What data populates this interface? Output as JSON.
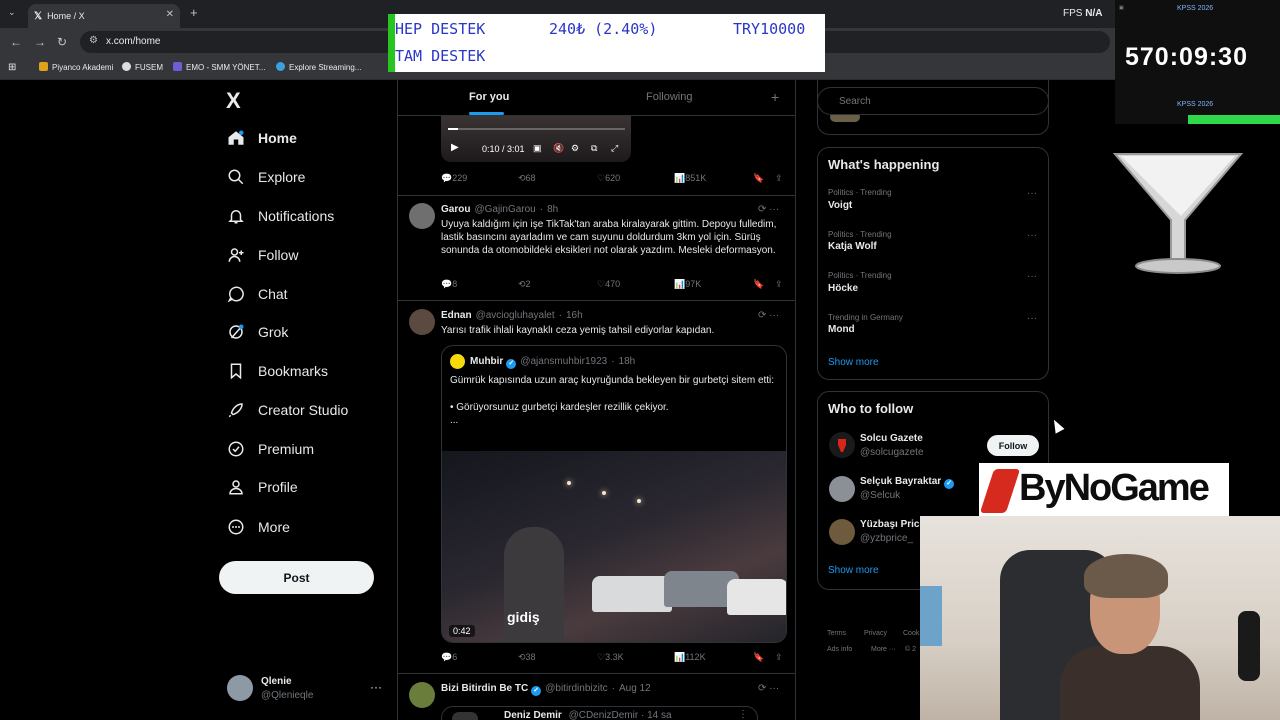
{
  "browser": {
    "tab_title": "Home / X",
    "url": "x.com/home",
    "fps_label": "FPS",
    "fps_value": "N/A",
    "bookmarks": [
      "Piyanco Akademi",
      "FUSEM",
      "EMO - SMM YÖNET...",
      "Explore Streaming..."
    ]
  },
  "nav": {
    "logo": "X",
    "items": [
      "Home",
      "Explore",
      "Notifications",
      "Follow",
      "Chat",
      "Grok",
      "Bookmarks",
      "Creator Studio",
      "Premium",
      "Profile",
      "More"
    ],
    "post_label": "Post",
    "profile_name": "Qlenie",
    "profile_handle": "@Qlenieqle"
  },
  "feed": {
    "tabs": [
      "For you",
      "Following"
    ],
    "video_time": "0:10 / 3:01",
    "tweet0_actions": {
      "reply": "229",
      "repost": "68",
      "like": "620",
      "views": "851K"
    },
    "tweets": [
      {
        "name": "Garou",
        "handle": "@GajinGarou",
        "time": "8h",
        "text": "Uyuya kaldığım için işe TikTak'tan araba kiralayarak gittim. Depoyu fulledim, lastik basıncını ayarladım ve cam suyunu doldurdum 3km yol için. Sürüş sonunda da otomobildeki eksikleri not olarak yazdım. Mesleki deformasyon.",
        "reply": "8",
        "repost": "2",
        "like": "470",
        "views": "97K"
      },
      {
        "name": "Ednan",
        "handle": "@avciogluhayalet",
        "time": "16h",
        "text": "Yarısı trafik ihlali kaynaklı ceza yemiş tahsil ediyorlar kapıdan.",
        "reply": "6",
        "repost": "38",
        "like": "3.3K",
        "views": "112K"
      },
      {
        "name": "Bizi Bitirdin Be TC",
        "handle": "@bitirdinbizitc",
        "time": "Aug 12"
      }
    ],
    "quote": {
      "name": "Muhbir",
      "handle": "@ajansmuhbir1923",
      "time": "18h",
      "text1": "Gümrük kapısında uzun araç kuyruğunda bekleyen bir gurbetçi sitem etti:",
      "text2": "• Görüyorsunuz gurbetçi kardeşler rezillik çekiyor.",
      "text3": "...",
      "subtitle": "gidiş",
      "duration": "0:42"
    },
    "next_quote_name": "Deniz Demir",
    "next_quote_meta": "@CDenizDemir · 14 sa"
  },
  "right": {
    "search_placeholder": "Search",
    "whats_happening_title": "What's happening",
    "trends": [
      {
        "category": "Politics · Trending",
        "name": "Voigt"
      },
      {
        "category": "Politics · Trending",
        "name": "Katja Wolf"
      },
      {
        "category": "Politics · Trending",
        "name": "Höcke"
      },
      {
        "category": "Trending in Germany",
        "name": "Mond"
      }
    ],
    "show_more": "Show more",
    "who_to_follow_title": "Who to follow",
    "suggestions": [
      {
        "name": "Solcu Gazete",
        "handle": "@solcugazete"
      },
      {
        "name": "Selçuk Bayraktar",
        "handle": "@Selcuk"
      },
      {
        "name": "Yüzbaşı Price",
        "handle": "@yzbprice_"
      }
    ],
    "follow_label": "Follow",
    "footer": [
      "Terms",
      "Privacy",
      "Cook",
      "Ads info",
      "More ···",
      "© 2"
    ]
  },
  "overlay": {
    "ticker_line1_left": "HEP DESTEK",
    "ticker_line1_mid": "240₺ (2.40%)",
    "ticker_line1_right": "TRY10000",
    "ticker_line2": "TAM DESTEK",
    "timer_label": "KPSS 2026",
    "timer_value": "570:09:30",
    "brand": "ByNoGame"
  }
}
